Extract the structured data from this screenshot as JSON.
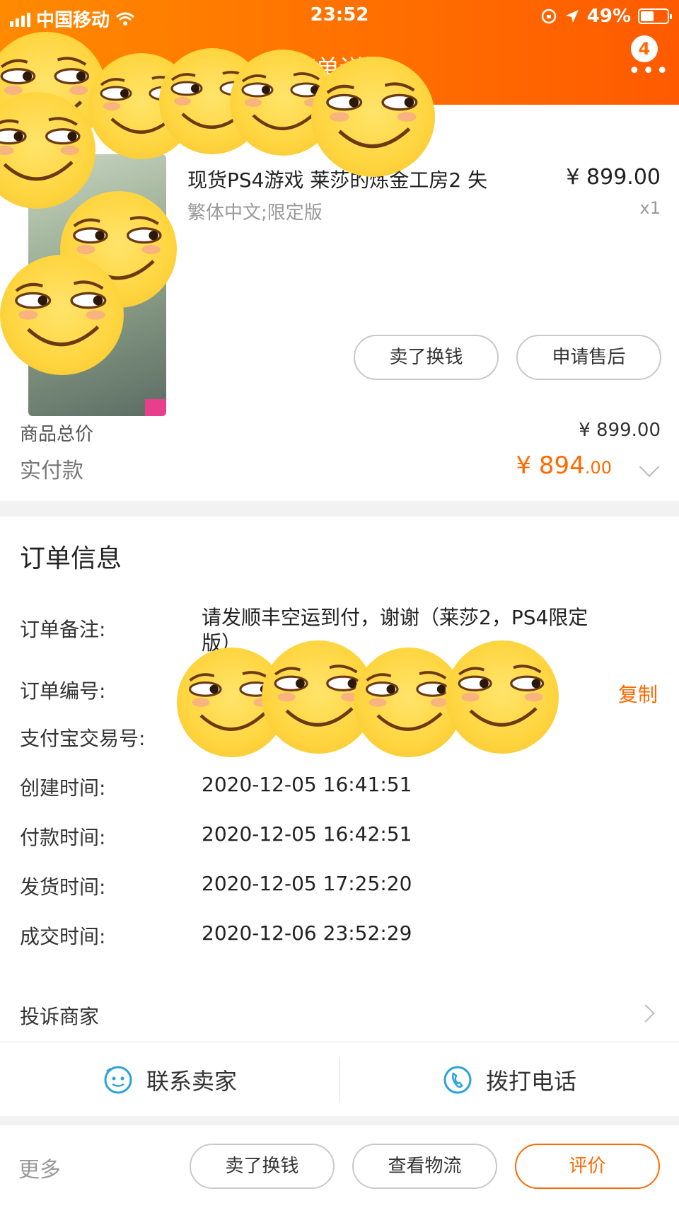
{
  "statusbar": {
    "carrier": "中国移动",
    "time": "23:52",
    "battery_pct": "49%"
  },
  "header": {
    "title": "订单详情",
    "badge_count": "4"
  },
  "product": {
    "title": "现货PS4游戏 莱莎的炼金工房2 失",
    "sku": "繁体中文;限定版",
    "price": "¥ 899.00",
    "qty": "x1",
    "buttons": {
      "sell": "卖了换钱",
      "after_sale": "申请售后"
    }
  },
  "summary": {
    "total_label": "商品总价",
    "total_value": "¥ 899.00",
    "paid_label": "实付款",
    "paid_integer": "¥ 894",
    "paid_decimal": ".00"
  },
  "order_info": {
    "title": "订单信息",
    "note_label": "订单备注:",
    "note_value": "请发顺丰空运到付，谢谢（莱莎2，PS4限定版）",
    "number_label": "订单编号:",
    "copy_label": "复制",
    "alipay_label": "支付宝交易号:",
    "rows": [
      {
        "label": "创建时间:",
        "value": "2020-12-05 16:41:51"
      },
      {
        "label": "付款时间:",
        "value": "2020-12-05 16:42:51"
      },
      {
        "label": "发货时间:",
        "value": "2020-12-05 17:25:20"
      },
      {
        "label": "成交时间:",
        "value": "2020-12-06 23:52:29"
      }
    ],
    "complaint_label": "投诉商家"
  },
  "contact": {
    "seller": "联系卖家",
    "phone": "拨打电话"
  },
  "bottom": {
    "more": "更多",
    "sell": "卖了换钱",
    "logistics": "查看物流",
    "review": "评价"
  },
  "colors": {
    "accent": "#ff6a00",
    "header_start": "#ff8a00",
    "header_end": "#ff5a00"
  }
}
